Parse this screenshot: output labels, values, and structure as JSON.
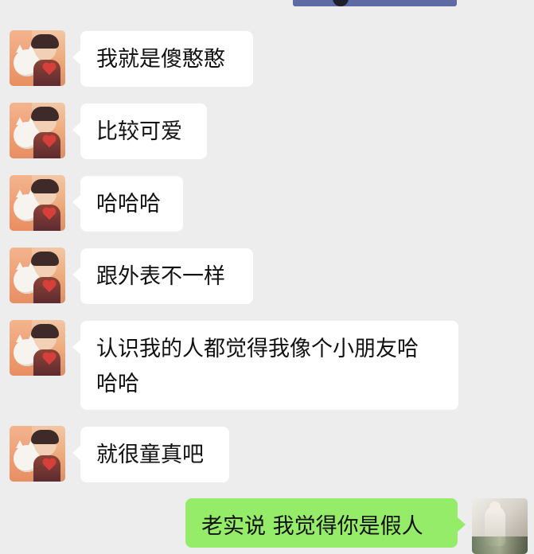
{
  "chat": {
    "messages": [
      {
        "side": "in",
        "text": "我就是傻憨憨"
      },
      {
        "side": "in",
        "text": "比较可爱"
      },
      {
        "side": "in",
        "text": "哈哈哈"
      },
      {
        "side": "in",
        "text": "跟外表不一样"
      },
      {
        "side": "in",
        "text": "认识我的人都觉得我像个小朋友哈\n哈哈"
      },
      {
        "side": "in",
        "text": "就很童真吧"
      },
      {
        "side": "out",
        "text": "老实说 我觉得你是假人"
      }
    ]
  },
  "colors": {
    "background": "#ededed",
    "incoming_bubble": "#ffffff",
    "outgoing_bubble": "#95ec69",
    "text": "#111111"
  },
  "icons": {
    "contact_avatar": "cartoon-boy-with-cat-avatar-icon",
    "self_avatar": "photo-avatar-icon",
    "top_image": "image-preview-icon"
  }
}
